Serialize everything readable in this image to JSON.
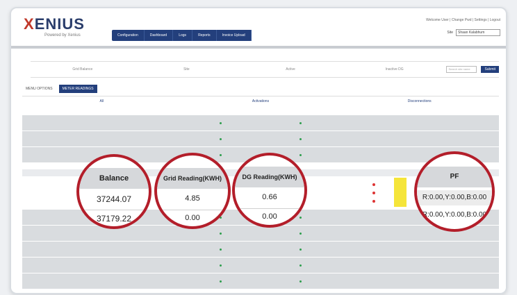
{
  "logo": {
    "word": "XENIUS",
    "sub": "Powered by Xenius"
  },
  "nav": [
    "Configuration",
    "Dashboard",
    "Logs",
    "Reports",
    "Invoice Upload"
  ],
  "toplinks": "Welcome User | Change Pwd | Settings | Logout",
  "site": {
    "label": "Site",
    "value": "Shaan Kalabhum"
  },
  "stats": [
    "Grid Balance",
    "Site",
    "Active",
    "Inactive DG"
  ],
  "search": {
    "placeholder": "Search site name",
    "button": "Submit"
  },
  "tabs": [
    "MENU OPTIONS",
    "METER READINGS"
  ],
  "sections": [
    "All",
    "Activations",
    "Disconnections"
  ],
  "circles": {
    "balance": {
      "header": "Balance",
      "values": [
        "37244.07",
        "37179.22"
      ]
    },
    "grid": {
      "header": "Grid Reading(KWH)",
      "values": [
        "4.85",
        "0.00"
      ]
    },
    "dg": {
      "header": "DG Reading(KWH)",
      "values": [
        "0.66",
        "0.00"
      ]
    },
    "pf": {
      "header": "PF",
      "values": [
        "R:0.00,Y:0.00,B:0.00",
        "R:0.00,Y:0.00,B:0.00"
      ]
    }
  },
  "colors": {
    "nav": "#233f7c",
    "circle_border": "#b31e2a",
    "highlight": "#f5e53a",
    "status_green": "#2e9e4e",
    "status_red": "#d33333"
  }
}
